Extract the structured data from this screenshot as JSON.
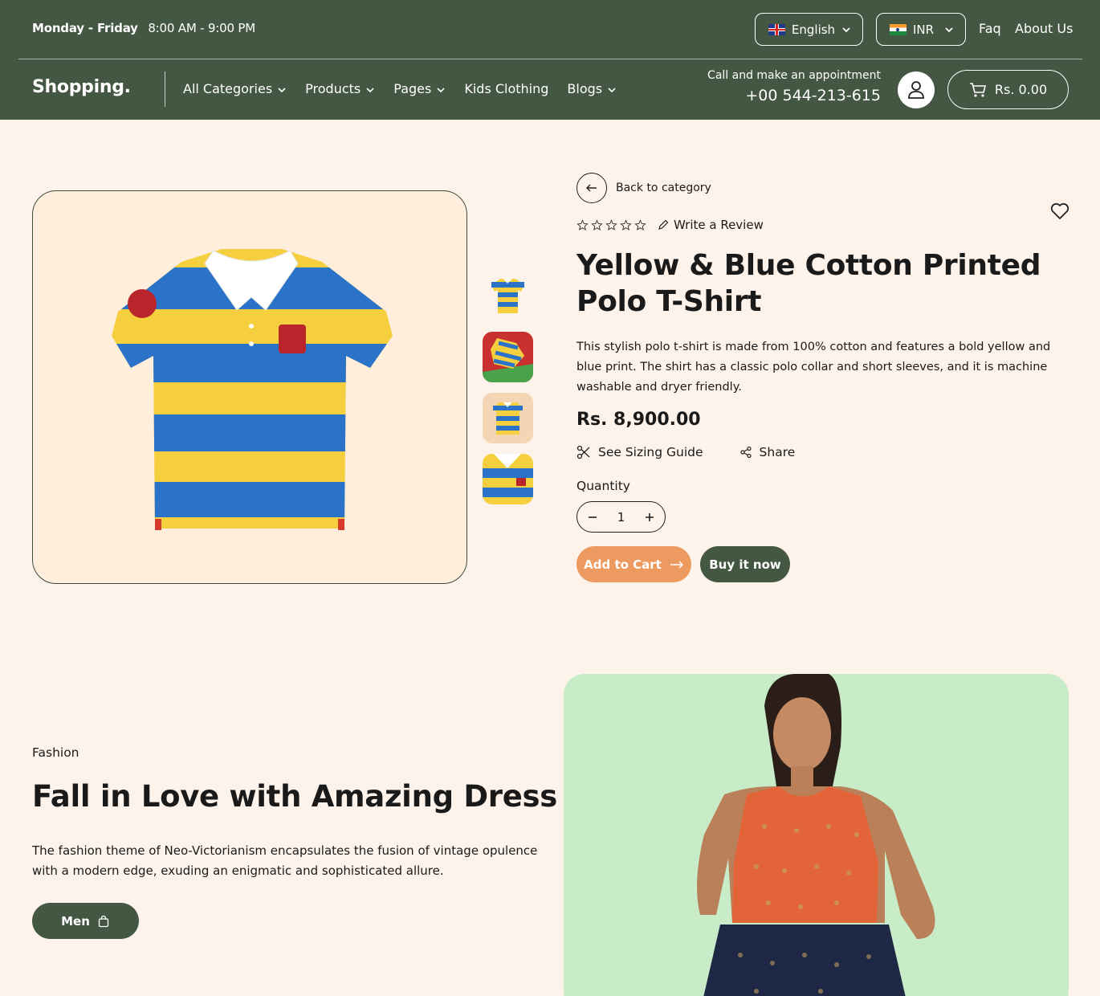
{
  "header": {
    "hours_days": "Monday - Friday",
    "hours_time": "8:00 AM - 9:00 PM",
    "language": "English",
    "currency": "INR",
    "faq": "Faq",
    "about": "About Us",
    "logo": "Shopping.",
    "nav": [
      "All Categories",
      "Products",
      "Pages",
      "Kids Clothing",
      "Blogs"
    ],
    "appointment_label": "Call and make an appointment",
    "phone": "+00 544-213-615",
    "cart_total": "Rs. 0.00"
  },
  "product": {
    "back_label": "Back to category",
    "review_label": "Write a Review",
    "rating": 0,
    "rating_max": 5,
    "title": "Yellow & Blue Cotton Printed Polo T-Shirt",
    "description": "This stylish polo t-shirt is made from 100% cotton and features a bold yellow and blue print. The shirt has a classic polo collar and short sleeves, and it is machine washable and dryer friendly.",
    "price": "Rs. 8,900.00",
    "sizing_label": "See Sizing Guide",
    "share_label": "Share",
    "quantity_label": "Quantity",
    "quantity": "1",
    "add_to_cart": "Add to Cart",
    "buy_now": "Buy it now"
  },
  "promo": {
    "eyebrow": "Fashion",
    "heading": "Fall in Love with Amazing Dress",
    "text": "The fashion theme of Neo-Victorianism encapsulates the fusion of vintage opulence with a modern edge, exuding an enigmatic and sophisticated allure.",
    "button": "Men"
  },
  "colors": {
    "header_bg": "#435743",
    "page_bg": "#fdf3ea",
    "accent_orange": "#ec9a60",
    "image_bg": "#ffeedc",
    "model_bg": "#c8ecc8"
  }
}
